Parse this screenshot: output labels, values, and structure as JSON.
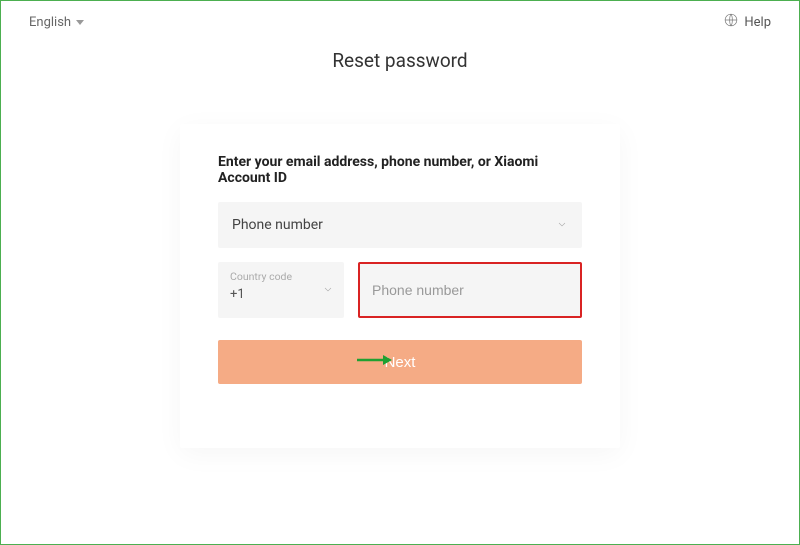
{
  "topbar": {
    "language": "English",
    "help_label": "Help"
  },
  "page": {
    "title": "Reset password"
  },
  "form": {
    "heading": "Enter your email address, phone number, or Xiaomi Account ID",
    "id_type": {
      "selected": "Phone number"
    },
    "country_code": {
      "label": "Country code",
      "value": "+1"
    },
    "phone_input": {
      "placeholder": "Phone number",
      "value": ""
    },
    "next_label": "Next"
  },
  "annotation": {
    "highlight_color": "#d92323",
    "arrow_color": "#1fa031"
  }
}
